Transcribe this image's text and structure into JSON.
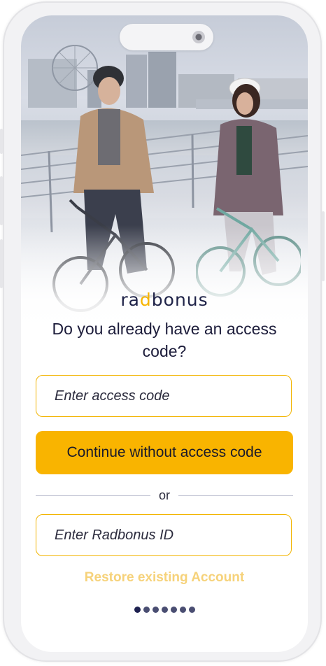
{
  "brand": {
    "logo_text_pre": "ra",
    "logo_text_accent": "d",
    "logo_text_post": "bonus"
  },
  "question": "Do you already have an access code?",
  "access_code_field": {
    "placeholder": "Enter access code"
  },
  "continue_button": {
    "label": "Continue without access code"
  },
  "divider": {
    "label": "or"
  },
  "radbonus_id_field": {
    "placeholder": "Enter Radbonus ID"
  },
  "restore_link": {
    "label": "Restore existing Account"
  },
  "pagination": {
    "total": 7,
    "active_index": 0
  },
  "colors": {
    "accent": "#f9b400",
    "navy": "#1e2150",
    "restore_text": "#f6d27a"
  }
}
